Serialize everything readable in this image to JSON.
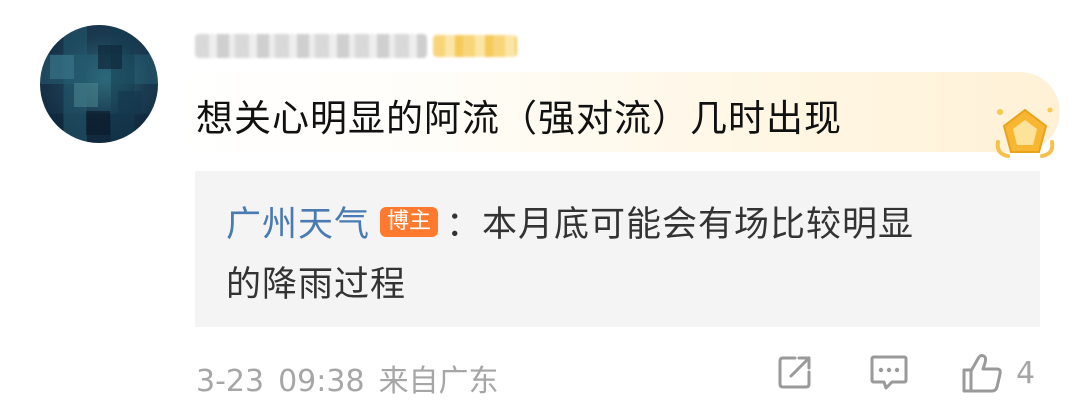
{
  "comment": {
    "text": "想关心明显的阿流（强对流）几时出现",
    "username_redacted": true
  },
  "reply": {
    "author": "广州天气",
    "author_tag": "博主",
    "separator": "：",
    "line1": "本月底可能会有场比较明显",
    "line2": "的降雨过程"
  },
  "footer": {
    "date": "3-23",
    "time": "09:38",
    "source": "来自广东",
    "like_count": "4"
  },
  "icons": {
    "share": "share-icon",
    "comment": "comment-icon",
    "like": "thumbs-up-icon",
    "badge": "vip-badge-icon"
  },
  "colors": {
    "author_link": "#4a7ab2",
    "tag_bg": "#ff7a2e",
    "meta_text": "#a6a6a6",
    "reply_bg": "#f4f4f4"
  }
}
